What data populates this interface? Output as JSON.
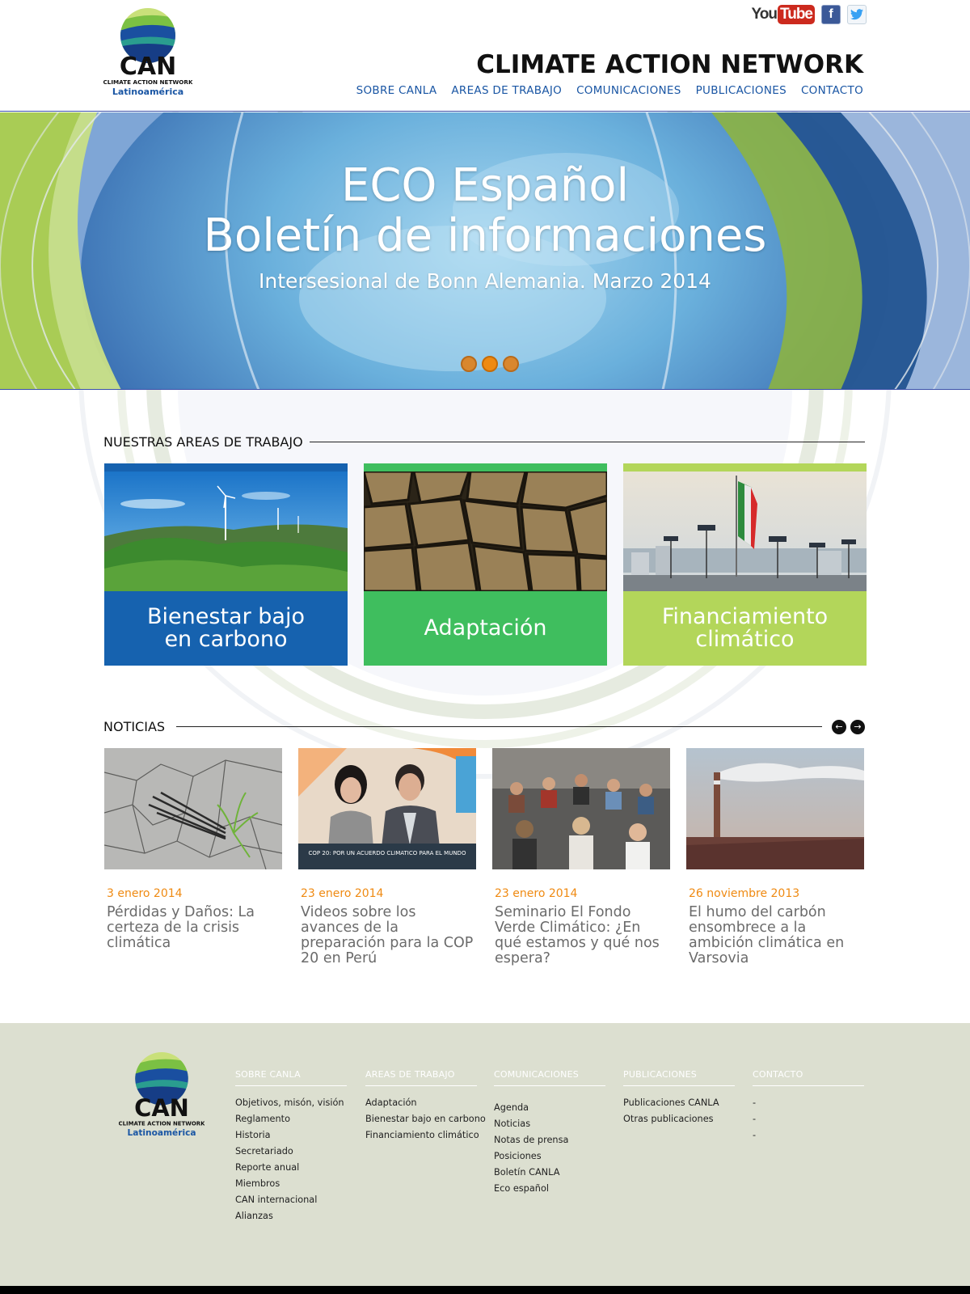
{
  "header": {
    "logo": {
      "initials": "CAN",
      "tagline": "CLIMATE ACTION NETWORK",
      "region": "Latinoamérica"
    },
    "social": [
      {
        "name": "youtube-icon",
        "label_a": "You",
        "label_b": "Tube"
      },
      {
        "name": "facebook-icon",
        "label": "f"
      },
      {
        "name": "twitter-icon",
        "label": "t"
      }
    ],
    "site_title": "CLIMATE ACTION NETWORK",
    "nav": [
      "SOBRE CANLA",
      "AREAS DE TRABAJO",
      "COMUNICACIONES",
      "PUBLICACIONES",
      "CONTACTO"
    ]
  },
  "hero": {
    "line1": "ECO Español",
    "line2": "Boletín de informaciones",
    "line3": "Intersesional de Bonn Alemania. Marzo 2014",
    "slides": 3,
    "active_slide": 2
  },
  "areas": {
    "heading": "NUESTRAS AREAS DE TRABAJO",
    "items": [
      {
        "line1": "Bienestar bajo",
        "line2": "en carbono"
      },
      {
        "line1": "Adaptación",
        "line2": ""
      },
      {
        "line1": "Financiamiento",
        "line2": "climático"
      }
    ]
  },
  "news": {
    "heading": "NOTICIAS",
    "prev": "←",
    "next": "→",
    "items": [
      {
        "date": "3 enero 2014",
        "title": "Pérdidas y Daños: La certeza de la crisis climática"
      },
      {
        "date": "23 enero 2014",
        "title": "Videos sobre los avances de la preparación para la COP 20 en Perú",
        "overlay": "COP 20: POR UN ACUERDO CLIMATICO PARA EL MUNDO"
      },
      {
        "date": "23 enero 2014",
        "title": "Seminario El Fondo Verde Climático: ¿En qué estamos y qué nos espera?"
      },
      {
        "date": "26 noviembre 2013",
        "title": "El humo del carbón ensombrece a la ambición climática en Varsovia"
      }
    ]
  },
  "footer": {
    "columns": [
      {
        "head": "SOBRE CANLA",
        "links": [
          "Objetivos, misón, visión",
          "Reglamento",
          "Historia",
          "Secretariado",
          "Reporte anual",
          "Miembros",
          "CAN internacional",
          "Alianzas"
        ]
      },
      {
        "head": "AREAS DE TRABAJO",
        "links": [
          "Adaptación",
          "Bienestar bajo en carbono",
          "Financiamiento climático"
        ]
      },
      {
        "head": "COMUNICACIONES",
        "links": [
          "Agenda",
          "Noticias",
          "Notas de prensa",
          "Posiciones",
          "Boletín CANLA",
          "Eco español"
        ]
      },
      {
        "head": "PUBLICACIONES",
        "links": [
          "Publicaciones CANLA",
          "Otras publicaciones"
        ]
      },
      {
        "head": "CONTACTO",
        "links": [
          "-",
          "-",
          "-"
        ]
      }
    ]
  },
  "colors": {
    "brand_blue": "#1662af",
    "brand_green": "#3fbe5e",
    "brand_lime": "#b3d65a",
    "accent_orange": "#ef8a12",
    "footer_bg": "#dcdfd0"
  }
}
